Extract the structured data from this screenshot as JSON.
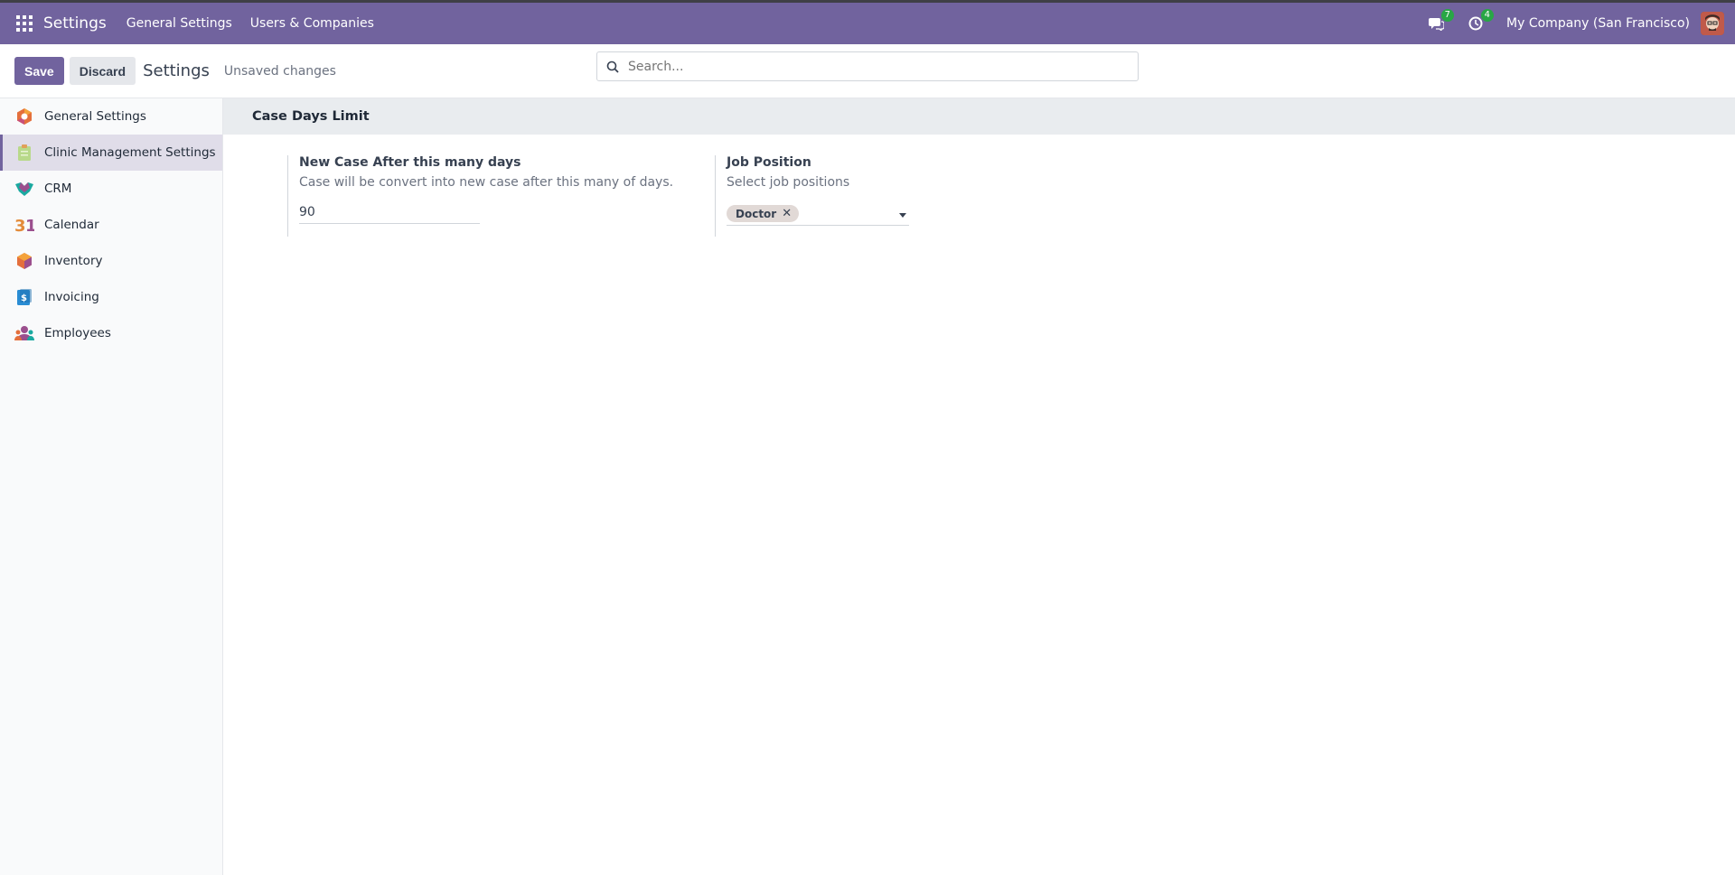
{
  "topbar": {
    "app_title": "Settings",
    "menu": [
      "General Settings",
      "Users & Companies"
    ],
    "messages_badge": "7",
    "activity_badge": "4",
    "company": "My Company (San Francisco)"
  },
  "control": {
    "save_label": "Save",
    "discard_label": "Discard",
    "title": "Settings",
    "status": "Unsaved changes",
    "search_placeholder": "Search..."
  },
  "sidebar": {
    "items": [
      {
        "label": "General Settings",
        "icon": "settings-app-icon"
      },
      {
        "label": "Clinic Management Settings",
        "icon": "clinic-icon",
        "active": true
      },
      {
        "label": "CRM",
        "icon": "crm-icon"
      },
      {
        "label": "Calendar",
        "icon": "calendar-icon"
      },
      {
        "label": "Inventory",
        "icon": "inventory-icon"
      },
      {
        "label": "Invoicing",
        "icon": "invoicing-icon"
      },
      {
        "label": "Employees",
        "icon": "employees-icon"
      }
    ]
  },
  "main": {
    "section_title": "Case Days Limit",
    "case_setting": {
      "label": "New Case After this many days",
      "description": "Case will be convert into new case after this many of days.",
      "value": "90"
    },
    "job_setting": {
      "label": "Job Position",
      "description": "Select job positions",
      "tags": [
        "Doctor"
      ]
    }
  },
  "colors": {
    "brand": "#71639e",
    "section_bg": "#e9ecef",
    "badge": "#28a745"
  }
}
